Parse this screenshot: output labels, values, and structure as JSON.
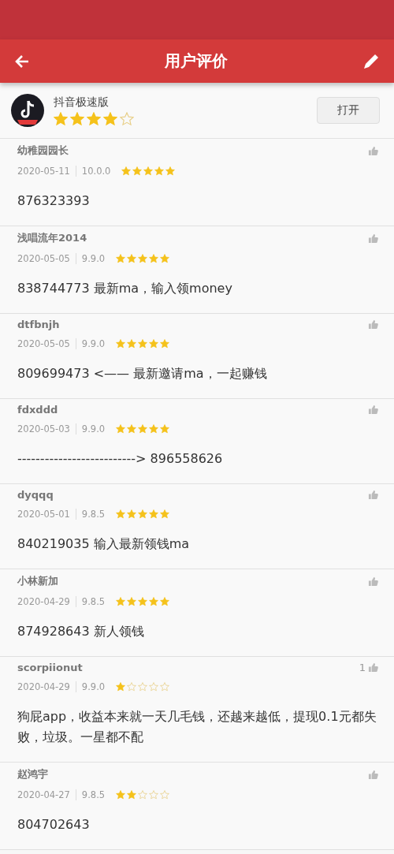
{
  "toolbar": {
    "title": "用户评价"
  },
  "app": {
    "name": "抖音极速版",
    "stars": 4,
    "open_button": "打开"
  },
  "reviews": [
    {
      "user": "幼稚园园长",
      "date": "2020-05-11",
      "version": "10.0.0",
      "stars": 5,
      "text": "876323393"
    },
    {
      "user": "浅唱流年2014",
      "date": "2020-05-05",
      "version": "9.9.0",
      "stars": 5,
      "text": "838744773  最新ma，输入领money"
    },
    {
      "user": "dtfbnjh",
      "date": "2020-05-05",
      "version": "9.9.0",
      "stars": 5,
      "text": "809699473 <—— 最新邀请ma，一起赚钱"
    },
    {
      "user": "fdxddd",
      "date": "2020-05-03",
      "version": "9.9.0",
      "stars": 5,
      "text": "-------------------------->   896558626"
    },
    {
      "user": "dyqqq",
      "date": "2020-05-01",
      "version": "9.8.5",
      "stars": 5,
      "text": "840219035    输入最新领钱ma"
    },
    {
      "user": "小林新加",
      "date": "2020-04-29",
      "version": "9.8.5",
      "stars": 5,
      "text": "874928643       新人领钱"
    },
    {
      "user": "scorpiionut",
      "date": "2020-04-29",
      "version": "9.9.0",
      "stars": 1,
      "likes": "1",
      "text": "狗屁app，收益本来就一天几毛钱，还越来越低，提现0.1元都失败，垃圾。一星都不配"
    },
    {
      "user": "赵鸿宇",
      "date": "2020-04-27",
      "version": "9.8.5",
      "stars": 2,
      "text": "804702643"
    }
  ]
}
